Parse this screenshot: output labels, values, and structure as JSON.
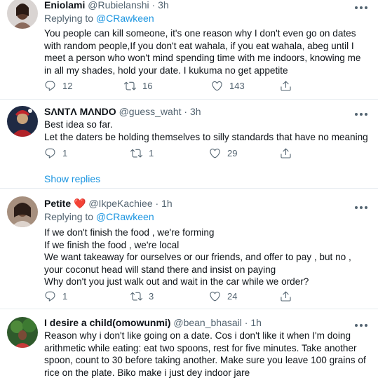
{
  "tweets": [
    {
      "name": "Eniolami",
      "handle": "@Rubielanshi",
      "time": "3h",
      "replying_label": "Replying to",
      "replying_to": "@CRawkeen",
      "lines": [
        "You people can kill someone, it's one reason why I don't even go on dates",
        "with random people,If you don't eat wahala, if you eat wahala, abeg until I",
        "meet a person who won't mind spending time with me indoors, knowing me",
        "in all my shades, hold your date. I kukuma no get appetite"
      ],
      "replies": "12",
      "retweets": "16",
      "likes": "143"
    },
    {
      "name": "SΛNTΛ MΛNDO",
      "handle": "@guess_waht",
      "time": "3h",
      "lines": [
        "Best idea so far.",
        "Let the daters be holding themselves to silly standards that have no meaning"
      ],
      "replies": "1",
      "retweets": "1",
      "likes": "29",
      "show_replies": "Show replies"
    },
    {
      "name": "Petite",
      "name_emoji": "❤️",
      "handle": "@IkpeKachiee",
      "time": "1h",
      "replying_label": "Replying to",
      "replying_to": "@CRawkeen",
      "lines": [
        "If we don't finish the food , we're forming",
        "If we finish the food , we're local",
        "We want takeaway for ourselves or our friends, and offer to pay , but no ,",
        "your coconut head will stand there and insist on paying",
        "Why don't you just walk out and wait in the car while we order?"
      ],
      "replies": "1",
      "retweets": "3",
      "likes": "24"
    },
    {
      "name": "I desire a child(omowunmi)",
      "handle": "@bean_bhasail",
      "time": "1h",
      "lines": [
        "Reason why i don't like going on a date. Cos i don't like it when I'm doing",
        "arithmetic while eating: eat two spoons, rest for five minutes. Take another",
        "spoon, count to 30 before taking another. Make sure you leave 100 grains of",
        "rice on the plate. Biko make i just dey indoor jare"
      ]
    }
  ],
  "dot": "·",
  "icons": {
    "reply": "reply-icon",
    "retweet": "retweet-icon",
    "like": "heart-icon",
    "share": "share-icon",
    "more": "more-icon"
  },
  "colors": {
    "link": "#1b95e0",
    "secondary": "#536471",
    "heart_emoji": "#e0245e"
  }
}
